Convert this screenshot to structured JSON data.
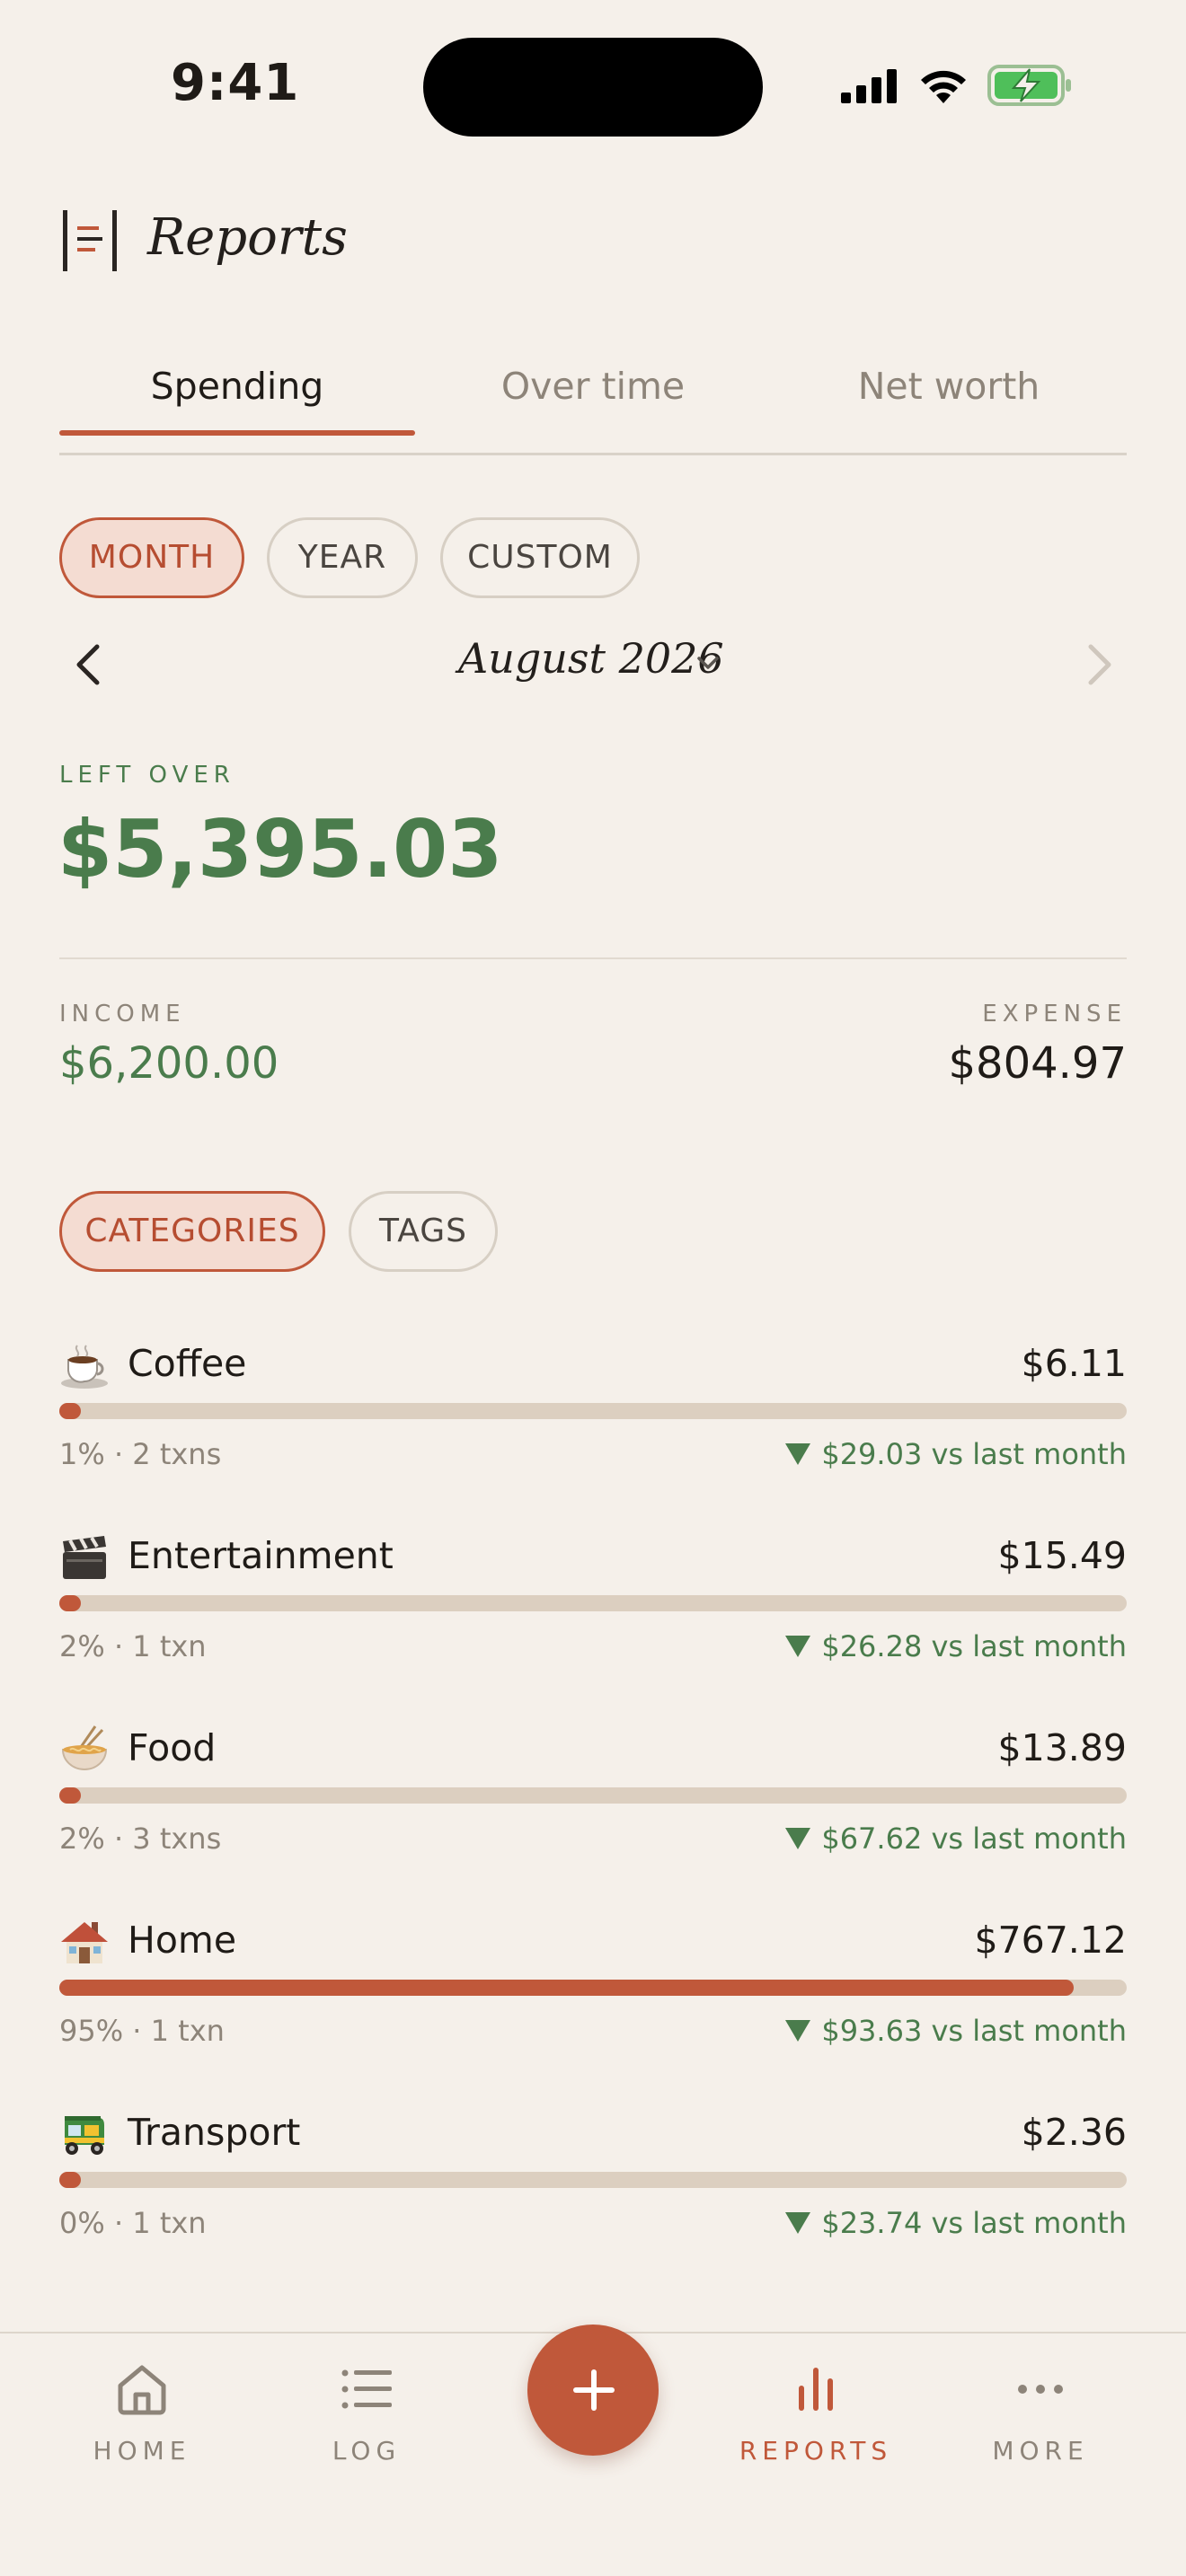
{
  "status_bar": {
    "time": "9:41"
  },
  "header": {
    "title": "Reports"
  },
  "tabs": [
    {
      "label": "Spending",
      "active": true
    },
    {
      "label": "Over time",
      "active": false
    },
    {
      "label": "Net worth",
      "active": false
    }
  ],
  "period_pills": [
    {
      "label": "MONTH",
      "active": true
    },
    {
      "label": "YEAR",
      "active": false
    },
    {
      "label": "CUSTOM",
      "active": false
    }
  ],
  "period": {
    "label": "August 2026"
  },
  "summary": {
    "left_over_label": "LEFT OVER",
    "left_over_value": "$5,395.03",
    "income_label": "INCOME",
    "income_value": "$6,200.00",
    "expense_label": "EXPENSE",
    "expense_value": "$804.97"
  },
  "breakdown_pills": [
    {
      "label": "CATEGORIES",
      "active": true
    },
    {
      "label": "TAGS",
      "active": false
    }
  ],
  "categories": [
    {
      "icon": "coffee-icon",
      "name": "Coffee",
      "amount": "$6.11",
      "meta": "1% · 2 txns",
      "delta": "$29.03 vs last month",
      "share": 0.01
    },
    {
      "icon": "clapperboard-icon",
      "name": "Entertainment",
      "amount": "$15.49",
      "meta": "2% · 1 txn",
      "delta": "$26.28 vs last month",
      "share": 0.02
    },
    {
      "icon": "noodle-bowl-icon",
      "name": "Food",
      "amount": "$13.89",
      "meta": "2% · 3 txns",
      "delta": "$67.62 vs last month",
      "share": 0.02
    },
    {
      "icon": "house-icon",
      "name": "Home",
      "amount": "$767.12",
      "meta": "95% · 1 txn",
      "delta": "$93.63 vs last month",
      "share": 0.95
    },
    {
      "icon": "auto-rickshaw-icon",
      "name": "Transport",
      "amount": "$2.36",
      "meta": "0% · 1 txn",
      "delta": "$23.74 vs last month",
      "share": 0.003
    }
  ],
  "bottom_nav": [
    {
      "label": "HOME",
      "icon": "home-icon",
      "active": false
    },
    {
      "label": "LOG",
      "icon": "list-icon",
      "active": false
    },
    {
      "label": "REPORTS",
      "icon": "bar-chart-icon",
      "active": true
    },
    {
      "label": "MORE",
      "icon": "more-icon",
      "active": false
    }
  ],
  "colors": {
    "background": "#f5f0ea",
    "accent": "#c0583a",
    "positive": "#4a7c4c",
    "muted": "#8d8479",
    "bar_track": "#dccfc0"
  }
}
